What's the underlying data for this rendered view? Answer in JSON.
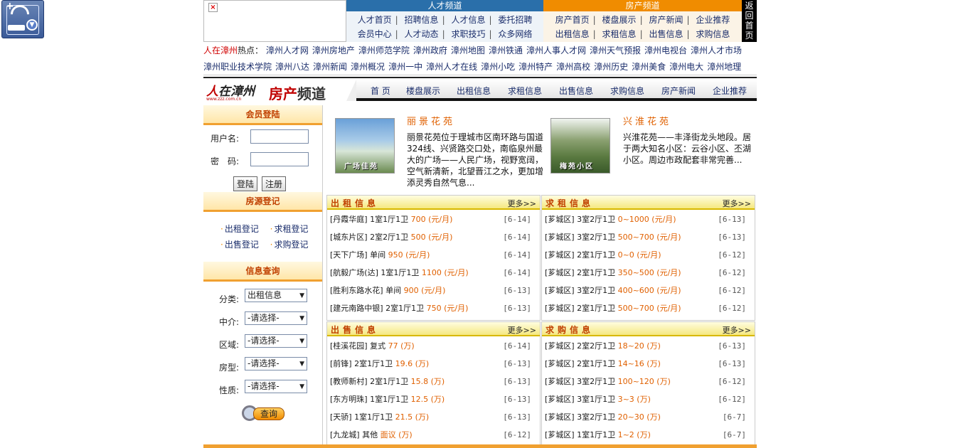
{
  "ad": {
    "close_symbol": "×"
  },
  "channel_talent": {
    "title": "人才频道",
    "row1": [
      "人才首页",
      "招聘信息",
      "人才信息",
      "委托招聘"
    ],
    "row2": [
      "会员中心",
      "人才动态",
      "求职技巧",
      "众多网络"
    ]
  },
  "channel_estate": {
    "title": "房产频道",
    "row1": [
      "房产首页",
      "楼盘展示",
      "房产新闻",
      "企业推荐"
    ],
    "row2": [
      "出租信息",
      "求租信息",
      "出售信息",
      "求购信息"
    ]
  },
  "back_home": "返回首页",
  "hot": {
    "prefix_red": "人在漳州",
    "prefix_black": "热点：",
    "line1": [
      "漳州人才网",
      "漳州房地产",
      "漳州师范学院",
      "漳州政府",
      "漳州地图",
      "漳州铁通",
      "漳州人事人才网",
      "漳州天气预报",
      "漳州电视台",
      "漳州人才市场"
    ],
    "line2": [
      "漳州职业技术学院",
      "漳州八达",
      "漳州新闻",
      "漳州概况",
      "漳州一中",
      "漳州人才在线",
      "漳州小吃",
      "漳州特产",
      "漳州高校",
      "漳州历史",
      "漳州美食",
      "漳州电大",
      "漳州地理"
    ]
  },
  "logo": {
    "text1": "在漳州",
    "text2_red": "房产",
    "text2_black": "频道",
    "url": "www.zzz.com.cn"
  },
  "nav": [
    "首 页",
    "楼盘展示",
    "出租信息",
    "求租信息",
    "出售信息",
    "求购信息",
    "房产新闻",
    "企业推荐"
  ],
  "login": {
    "title": "会员登陆",
    "username_label": "用户名:",
    "password_label": "密　码:",
    "login_button": "登陆",
    "register_button": "注册"
  },
  "register": {
    "title": "房源登记",
    "links": [
      "出租登记",
      "求租登记",
      "出售登记",
      "求购登记"
    ]
  },
  "query": {
    "title": "信息查询",
    "fields": [
      {
        "label": "分类:",
        "value": "出租信息"
      },
      {
        "label": "中介:",
        "value": "-请选择-"
      },
      {
        "label": "区域:",
        "value": "-请选择-"
      },
      {
        "label": "房型:",
        "value": "-请选择-"
      },
      {
        "label": "性质:",
        "value": "-请选择-"
      }
    ],
    "button": "查询"
  },
  "featured": [
    {
      "title": "丽景花苑",
      "photo_caption": "广场佳苑",
      "desc": "丽景花苑位于理城市区南环路与国道324线、兴贤路交口处，南临泉州最大的广场——人民广场，视野宽阔，空气新清新，北望晋江之水，更加增添灵秀自然气息..."
    },
    {
      "title": "兴淮花苑",
      "photo_caption": "梅苑小区",
      "desc": "兴淮花苑——丰泽街龙头地段。居于两大知名小区：云谷小区、丕湖小区。周边市政配套非常完善..."
    }
  ],
  "more_label": "更多>>",
  "boxes": [
    {
      "title": "出租信息",
      "items": [
        {
          "text": "[丹霞华庭] 1室1厅1卫",
          "price": "700 (元/月)",
          "date": "[6-14]"
        },
        {
          "text": "[城东片区] 2室2厅1卫",
          "price": "500 (元/月)",
          "date": "[6-14]"
        },
        {
          "text": "[天下广场] 单间",
          "price": "950 (元/月)",
          "date": "[6-14]"
        },
        {
          "text": "[航毅广场(达] 1室1厅1卫",
          "price": "1100 (元/月)",
          "date": "[6-14]"
        },
        {
          "text": "[胜利东路水花] 单间",
          "price": "900 (元/月)",
          "date": "[6-13]"
        },
        {
          "text": "[建元南路中银] 2室1厅1卫",
          "price": "750 (元/月)",
          "date": "[6-13]"
        }
      ]
    },
    {
      "title": "求租信息",
      "items": [
        {
          "text": "[芗城区] 3室2厅1卫",
          "price": "0~1000 (元/月)",
          "date": "[6-13]"
        },
        {
          "text": "[芗城区] 3室2厅1卫",
          "price": "500~700 (元/月)",
          "date": "[6-13]"
        },
        {
          "text": "[芗城区] 2室1厅1卫",
          "price": "0~0 (元/月)",
          "date": "[6-12]"
        },
        {
          "text": "[芗城区] 2室1厅1卫",
          "price": "350~500 (元/月)",
          "date": "[6-12]"
        },
        {
          "text": "[芗城区] 3室2厅1卫",
          "price": "400~600 (元/月)",
          "date": "[6-12]"
        },
        {
          "text": "[芗城区] 2室1厅1卫",
          "price": "500~700 (元/月)",
          "date": "[6-12]"
        }
      ]
    },
    {
      "title": "出售信息",
      "items": [
        {
          "text": "[桂溪花园] 复式",
          "price": "77 (万)",
          "date": "[6-14]"
        },
        {
          "text": "[前锋] 2室1厅1卫",
          "price": "19.6 (万)",
          "date": "[6-13]"
        },
        {
          "text": "[教师新村] 2室1厅1卫",
          "price": "15.8 (万)",
          "date": "[6-13]"
        },
        {
          "text": "[东方明珠] 1室1厅1卫",
          "price": "12.5 (万)",
          "date": "[6-13]"
        },
        {
          "text": "[天骄] 1室1厅1卫",
          "price": "21.5 (万)",
          "date": "[6-13]"
        },
        {
          "text": "[九龙城] 其他",
          "price": "面议 (万)",
          "date": "[6-12]"
        }
      ]
    },
    {
      "title": "求购信息",
      "items": [
        {
          "text": "[芗城区] 2室2厅1卫",
          "price": "18~20 (万)",
          "date": "[6-13]"
        },
        {
          "text": "[芗城区] 2室1厅1卫",
          "price": "14~16 (万)",
          "date": "[6-13]"
        },
        {
          "text": "[芗城区] 3室2厅1卫",
          "price": "100~120 (万)",
          "date": "[6-12]"
        },
        {
          "text": "[芗城区] 3室1厅1卫",
          "price": "3~3 (万)",
          "date": "[6-12]"
        },
        {
          "text": "[芗城区] 3室2厅1卫",
          "price": "20~30 (万)",
          "date": "[6-7]"
        },
        {
          "text": "[芗城区] 1室1厅1卫",
          "price": "1~2 (万)",
          "date": "[6-7]"
        }
      ]
    }
  ]
}
